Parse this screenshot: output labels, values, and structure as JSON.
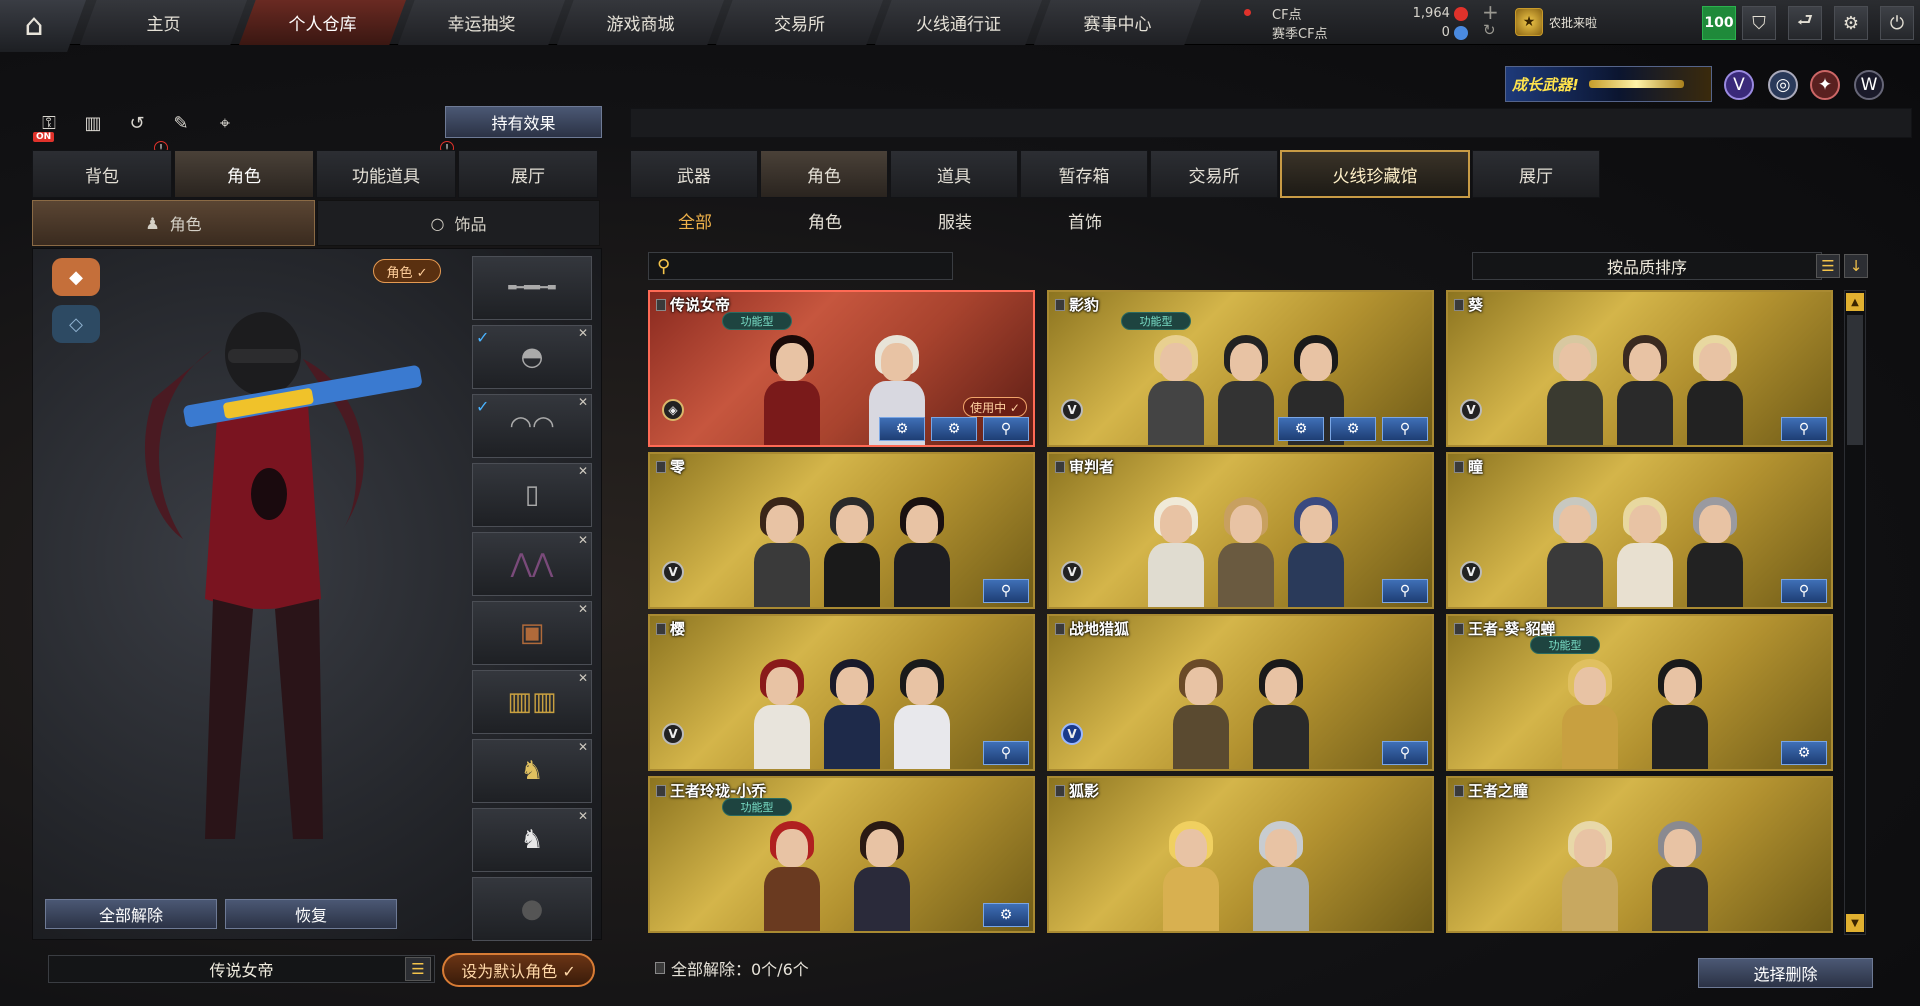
{
  "nav": {
    "items": [
      {
        "label": "主页"
      },
      {
        "label": "个人仓库"
      },
      {
        "label": "幸运抽奖"
      },
      {
        "label": "游戏商城"
      },
      {
        "label": "交易所"
      },
      {
        "label": "火线通行证"
      },
      {
        "label": "赛事中心"
      }
    ],
    "active": "个人仓库"
  },
  "currency": {
    "cf_label": "CF点",
    "cf_value": "1,964",
    "season_label": "赛季CF点",
    "season_value": "0"
  },
  "user": {
    "name": "农批来啦",
    "level": "100"
  },
  "promo": {
    "text": "成长武器!"
  },
  "left": {
    "effect_button": "持有效果",
    "tabs": [
      {
        "label": "背包"
      },
      {
        "label": "角色"
      },
      {
        "label": "功能道具"
      },
      {
        "label": "展厅"
      }
    ],
    "subtabs": [
      {
        "label": "角色"
      },
      {
        "label": "饰品"
      }
    ],
    "role_tag": "角色 ✓",
    "unequip_all": "全部解除",
    "restore": "恢复",
    "character_name": "传说女帝",
    "set_default": "设为默认角色 ✓",
    "on_label": "ON"
  },
  "right": {
    "tabs": [
      {
        "label": "武器"
      },
      {
        "label": "角色"
      },
      {
        "label": "道具"
      },
      {
        "label": "暂存箱"
      },
      {
        "label": "交易所"
      },
      {
        "label": "火线珍藏馆"
      },
      {
        "label": "展厅"
      }
    ],
    "filters": [
      {
        "label": "全部"
      },
      {
        "label": "角色"
      },
      {
        "label": "服装"
      },
      {
        "label": "首饰"
      }
    ],
    "sort_label": "按品质排序",
    "cards": [
      {
        "title": "传说女帝",
        "type": "功能型",
        "in_use": "使用中 ✓"
      },
      {
        "title": "影豹",
        "type": "功能型"
      },
      {
        "title": "葵"
      },
      {
        "title": "零"
      },
      {
        "title": "审判者"
      },
      {
        "title": "瞳"
      },
      {
        "title": "樱"
      },
      {
        "title": "战地猎狐"
      },
      {
        "title": "王者-葵-貂蝉",
        "type": "功能型"
      },
      {
        "title": "王者玲珑-小乔",
        "type": "功能型"
      },
      {
        "title": "狐影"
      },
      {
        "title": "王者之瞳"
      }
    ],
    "footer": "全部解除：0个/6个",
    "delete_button": "选择删除"
  },
  "colors": {
    "accent_red": "#e0322b",
    "card_gold": "#d4b54a",
    "active_orange": "#f0b24a",
    "level_green": "#1f8a3a"
  }
}
